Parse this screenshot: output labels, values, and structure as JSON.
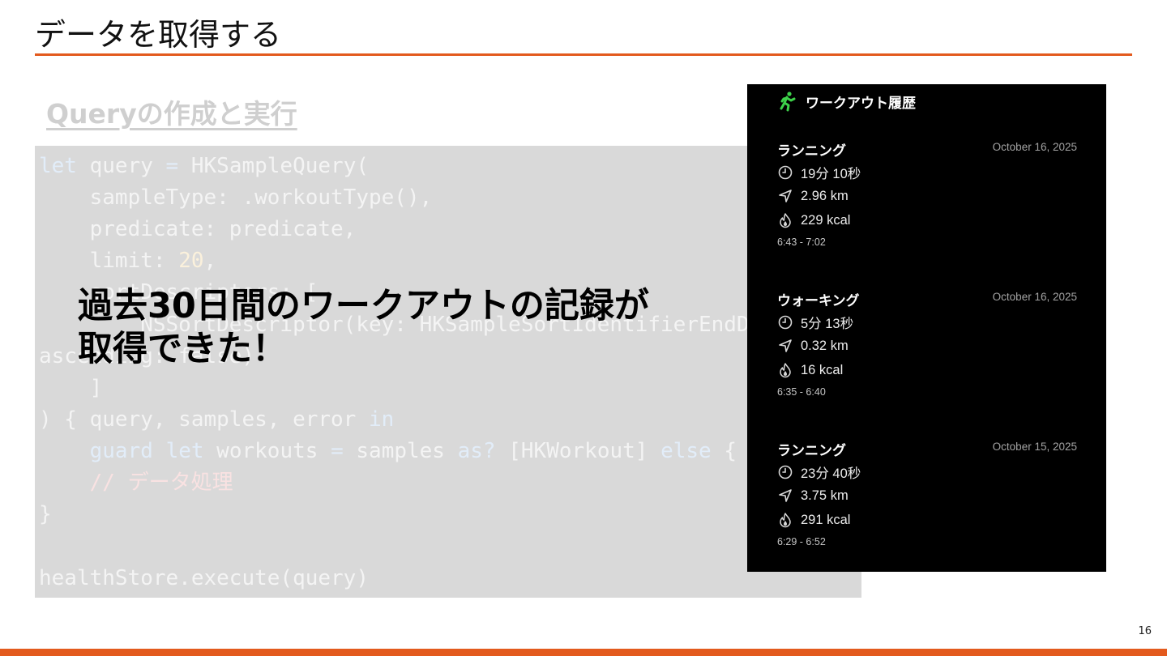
{
  "slide": {
    "title": "データを取得する",
    "page_number": "16"
  },
  "section": {
    "heading": "Queryの作成と実行"
  },
  "code": {
    "l1": {
      "kw": "let",
      "rest": " query ",
      "eq": "=",
      "rest2": " HKSampleQuery("
    },
    "l2": "    sampleType: .workoutType(),",
    "l3": "    predicate: predicate,",
    "l4": {
      "pre": "    limit: ",
      "num": "20",
      "post": ","
    },
    "l5": "    sortDescriptors: [",
    "l6": "        NSSortDescriptor(key: HKSampleSortIdentifierEndDate,",
    "l7": "ascending: false)",
    "l8": "    ]",
    "l9": {
      "pre": ") { query, samples, error ",
      "kw": "in"
    },
    "l10": {
      "guard": "guard",
      "let": "let",
      "workouts": " workouts ",
      "eq": "=",
      "samples": " samples ",
      "as": "as?",
      "type": " [HKWorkout] ",
      "else": "else",
      "brace": " {"
    },
    "l11": "    // データ処理",
    "l12": "}",
    "l13": "healthStore.execute(query)"
  },
  "overlay": {
    "line1": "過去30日間のワークアウトの記録が",
    "line2": "取得できた！"
  },
  "app": {
    "title": "ワークアウト履歴",
    "header_icon": "running-figure-icon",
    "accent_color": "#3dd24a",
    "workouts": [
      {
        "name": "ランニング",
        "date": "October 16, 2025",
        "duration": "19分 10秒",
        "distance": "2.96 km",
        "calories": "229 kcal",
        "time_range": "6:43 - 7:02"
      },
      {
        "name": "ウォーキング",
        "date": "October 16, 2025",
        "duration": "5分 13秒",
        "distance": "0.32 km",
        "calories": "16 kcal",
        "time_range": "6:35 - 6:40"
      },
      {
        "name": "ランニング",
        "date": "October 15, 2025",
        "duration": "23分 40秒",
        "distance": "3.75 km",
        "calories": "291 kcal",
        "time_range": "6:29 - 6:52"
      }
    ],
    "stat_icons": [
      "clock-icon",
      "location-arrow-icon",
      "flame-icon"
    ]
  }
}
